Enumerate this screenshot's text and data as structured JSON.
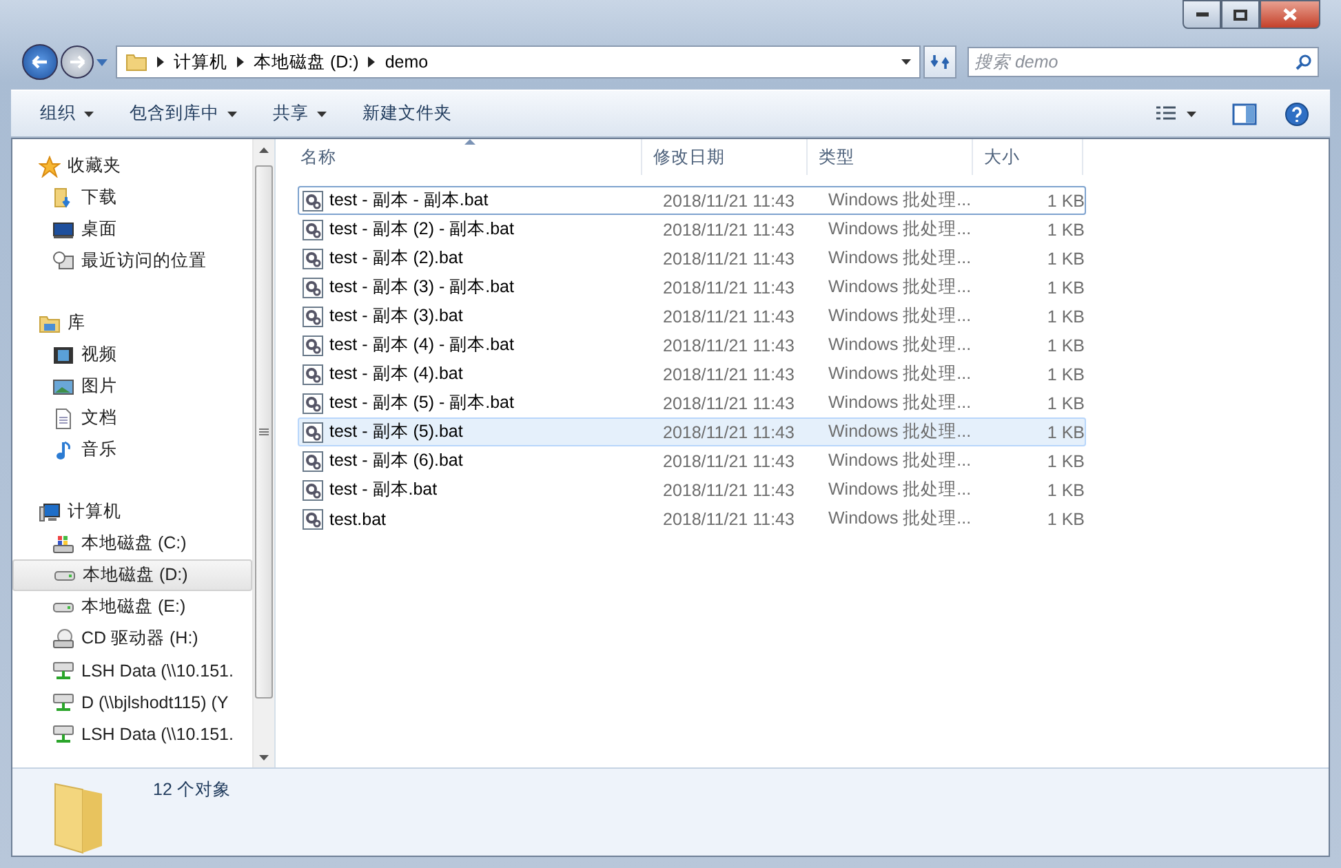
{
  "address_bar": {
    "breadcrumbs": [
      "计算机",
      "本地磁盘 (D:)",
      "demo"
    ]
  },
  "search": {
    "placeholder": "搜索 demo"
  },
  "toolbar": {
    "buttons": [
      {
        "label": "组织",
        "dropdown": true
      },
      {
        "label": "包含到库中",
        "dropdown": true
      },
      {
        "label": "共享",
        "dropdown": true
      },
      {
        "label": "新建文件夹",
        "dropdown": false
      }
    ]
  },
  "sidebar": {
    "sections": [
      {
        "label": "收藏夹",
        "kind": "favorites",
        "children": [
          {
            "label": "下载",
            "kind": "download",
            "selected": false
          },
          {
            "label": "桌面",
            "kind": "desktop",
            "selected": false
          },
          {
            "label": "最近访问的位置",
            "kind": "recent",
            "selected": false
          }
        ]
      },
      {
        "label": "库",
        "kind": "library",
        "children": [
          {
            "label": "视频",
            "kind": "video",
            "selected": false
          },
          {
            "label": "图片",
            "kind": "picture",
            "selected": false
          },
          {
            "label": "文档",
            "kind": "document",
            "selected": false
          },
          {
            "label": "音乐",
            "kind": "music",
            "selected": false
          }
        ]
      },
      {
        "label": "计算机",
        "kind": "computer",
        "children": [
          {
            "label": "本地磁盘 (C:)",
            "kind": "system-drive",
            "selected": false
          },
          {
            "label": "本地磁盘 (D:)",
            "kind": "drive",
            "selected": true
          },
          {
            "label": "本地磁盘 (E:)",
            "kind": "drive",
            "selected": false
          },
          {
            "label": "CD 驱动器 (H:)",
            "kind": "cd",
            "selected": false
          },
          {
            "label": "LSH Data (\\\\10.151.",
            "kind": "network",
            "selected": false
          },
          {
            "label": "D (\\\\bjlshodt115) (Y",
            "kind": "network",
            "selected": false
          },
          {
            "label": "LSH Data (\\\\10.151.",
            "kind": "network",
            "selected": false
          }
        ]
      }
    ]
  },
  "table": {
    "columns": [
      "名称",
      "修改日期",
      "类型",
      "大小"
    ],
    "rows": [
      {
        "name": "test - 副本 - 副本.bat",
        "modified": "2018/11/21 11:43",
        "type": "Windows 批处理...",
        "size": "1 KB",
        "selected": false,
        "focused": true
      },
      {
        "name": "test - 副本 (2) - 副本.bat",
        "modified": "2018/11/21 11:43",
        "type": "Windows 批处理...",
        "size": "1 KB",
        "selected": false,
        "focused": false
      },
      {
        "name": "test - 副本 (2).bat",
        "modified": "2018/11/21 11:43",
        "type": "Windows 批处理...",
        "size": "1 KB",
        "selected": false,
        "focused": false
      },
      {
        "name": "test - 副本 (3) - 副本.bat",
        "modified": "2018/11/21 11:43",
        "type": "Windows 批处理...",
        "size": "1 KB",
        "selected": false,
        "focused": false
      },
      {
        "name": "test - 副本 (3).bat",
        "modified": "2018/11/21 11:43",
        "type": "Windows 批处理...",
        "size": "1 KB",
        "selected": false,
        "focused": false
      },
      {
        "name": "test - 副本 (4) - 副本.bat",
        "modified": "2018/11/21 11:43",
        "type": "Windows 批处理...",
        "size": "1 KB",
        "selected": false,
        "focused": false
      },
      {
        "name": "test - 副本 (4).bat",
        "modified": "2018/11/21 11:43",
        "type": "Windows 批处理...",
        "size": "1 KB",
        "selected": false,
        "focused": false
      },
      {
        "name": "test - 副本 (5) - 副本.bat",
        "modified": "2018/11/21 11:43",
        "type": "Windows 批处理...",
        "size": "1 KB",
        "selected": false,
        "focused": false
      },
      {
        "name": "test - 副本 (5).bat",
        "modified": "2018/11/21 11:43",
        "type": "Windows 批处理...",
        "size": "1 KB",
        "selected": true,
        "focused": false
      },
      {
        "name": "test - 副本 (6).bat",
        "modified": "2018/11/21 11:43",
        "type": "Windows 批处理...",
        "size": "1 KB",
        "selected": false,
        "focused": false
      },
      {
        "name": "test - 副本.bat",
        "modified": "2018/11/21 11:43",
        "type": "Windows 批处理...",
        "size": "1 KB",
        "selected": false,
        "focused": false
      },
      {
        "name": "test.bat",
        "modified": "2018/11/21 11:43",
        "type": "Windows 批处理...",
        "size": "1 KB",
        "selected": false,
        "focused": false
      }
    ]
  },
  "status_bar": {
    "text": "12 个对象"
  }
}
